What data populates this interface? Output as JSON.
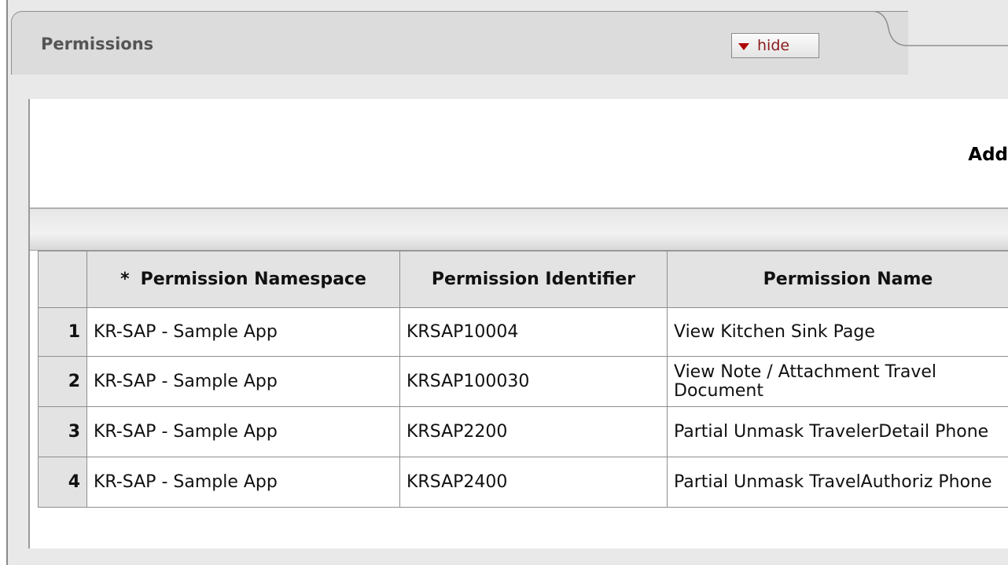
{
  "panel": {
    "title": "Permissions",
    "hide_label": "hide",
    "add_label": "Add"
  },
  "table": {
    "columns": {
      "required_marker": "*",
      "namespace": "Permission Namespace",
      "identifier": "Permission Identifier",
      "name": "Permission Name"
    },
    "rows": [
      {
        "num": "1",
        "namespace": "KR-SAP - Sample App",
        "identifier": "KRSAP10004",
        "name": "View Kitchen Sink Page"
      },
      {
        "num": "2",
        "namespace": "KR-SAP - Sample App",
        "identifier": "KRSAP100030",
        "name": "View Note / Attachment Travel Document"
      },
      {
        "num": "3",
        "namespace": "KR-SAP - Sample App",
        "identifier": "KRSAP2200",
        "name": "Partial Unmask TravelerDetail Phone"
      },
      {
        "num": "4",
        "namespace": "KR-SAP - Sample App",
        "identifier": "KRSAP2400",
        "name": "Partial Unmask TravelAuthoriz Phone"
      }
    ]
  },
  "colors": {
    "panel_bg": "#e9e9e9",
    "header_bg": "#e3e3e3",
    "hide_text": "#8b1a1a",
    "hide_arrow": "#b00000",
    "title_text": "#555555"
  },
  "icons": {
    "hide": "triangle-down-icon"
  }
}
